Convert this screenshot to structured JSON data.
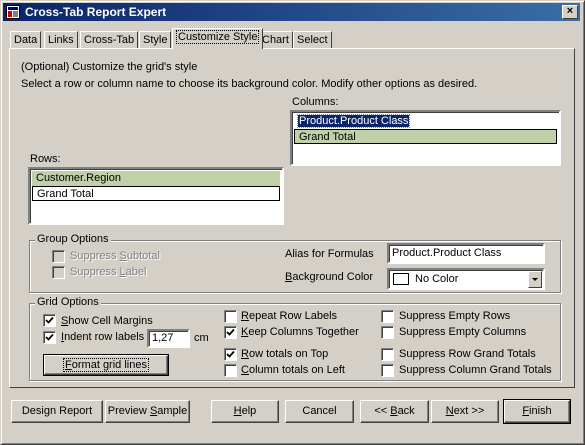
{
  "window": {
    "title": "Cross-Tab Report Expert",
    "close": "×"
  },
  "tabs": [
    {
      "label": "Data"
    },
    {
      "label": "Links"
    },
    {
      "label": "Cross-Tab"
    },
    {
      "label": "Style"
    },
    {
      "label": "Customize Style"
    },
    {
      "label": "Chart"
    },
    {
      "label": "Select"
    }
  ],
  "intro": {
    "line1": "(Optional) Customize the grid's style",
    "line2": "Select a row or column name to choose its background color.  Modify other options as desired."
  },
  "columns": {
    "label": "Columns:",
    "items": [
      "Product.Product Class",
      "Grand Total"
    ]
  },
  "rows": {
    "label": "Rows:",
    "items": [
      "Customer.Region",
      "Grand Total"
    ]
  },
  "group_options": {
    "title": "Group Options",
    "suppress_subtotal": "Suppress Subtotal",
    "suppress_label": "Suppress Label",
    "alias_label": "Alias for Formulas",
    "alias_value": "Product.Product Class",
    "bg_color_label": "Background Color",
    "bg_color_value": "No Color"
  },
  "grid_options": {
    "title": "Grid  Options",
    "show_cell_margins": "Show Cell Margins",
    "indent_row_labels": "Indent row labels",
    "indent_value": "1,27",
    "indent_unit": "cm",
    "format_grid_lines": "Format grid lines",
    "repeat_row_labels": "Repeat Row Labels",
    "keep_columns_together": "Keep Columns Together",
    "row_totals_on_top": "Row totals on Top",
    "column_totals_on_left": "Column totals on Left",
    "suppress_empty_rows": "Suppress Empty Rows",
    "suppress_empty_columns": "Suppress Empty Columns",
    "suppress_row_grand_totals": "Suppress Row Grand Totals",
    "suppress_column_grand_totals": "Suppress Column Grand Totals"
  },
  "buttons": {
    "design_report": "Design Report",
    "preview_sample": "Preview Sample",
    "help": "Help",
    "cancel": "Cancel",
    "back": "<< Back",
    "next": "Next >>",
    "finish": "Finish"
  },
  "colors": {
    "title_start": "#0a246a",
    "title_end": "#3a6ea5",
    "selected_item": "#c0d0a8",
    "face": "#d4d0c8"
  }
}
